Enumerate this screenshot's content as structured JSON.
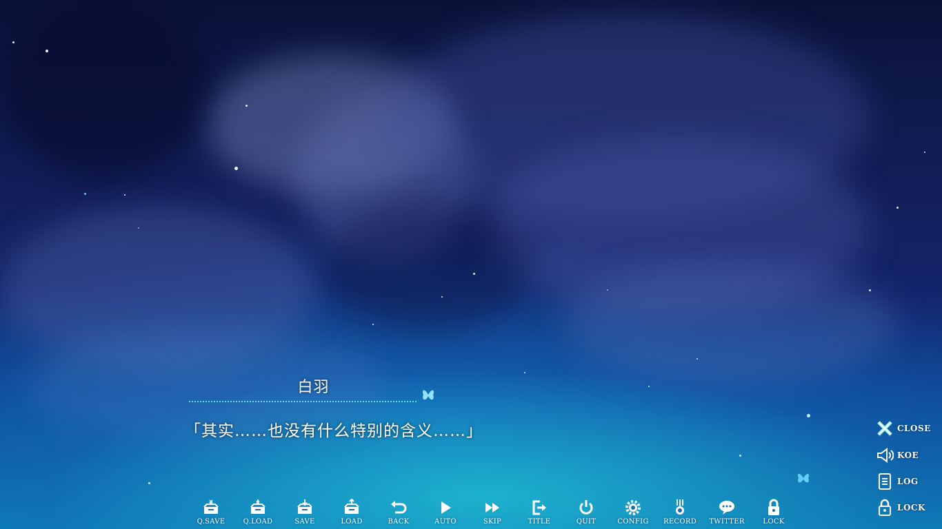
{
  "dialogue": {
    "speaker": "白羽",
    "text": "「其实……也没有什么特别的含义……」"
  },
  "toolbar": [
    {
      "id": "qsave",
      "label": "Q.SAVE",
      "icon": "quick-save-icon"
    },
    {
      "id": "qload",
      "label": "Q.LOAD",
      "icon": "quick-load-icon"
    },
    {
      "id": "save",
      "label": "SAVE",
      "icon": "save-icon"
    },
    {
      "id": "load",
      "label": "LOAD",
      "icon": "load-icon"
    },
    {
      "id": "back",
      "label": "BACK",
      "icon": "back-arrow-icon"
    },
    {
      "id": "auto",
      "label": "AUTO",
      "icon": "play-icon"
    },
    {
      "id": "skip",
      "label": "SKIP",
      "icon": "fast-forward-icon"
    },
    {
      "id": "title",
      "label": "TITLE",
      "icon": "exit-to-title-icon"
    },
    {
      "id": "quit",
      "label": "QUIT",
      "icon": "power-icon"
    },
    {
      "id": "config",
      "label": "CONFIG",
      "icon": "gear-icon"
    },
    {
      "id": "record",
      "label": "RECORD",
      "icon": "medal-icon"
    },
    {
      "id": "twitter",
      "label": "TWITTER",
      "icon": "speech-bubble-icon"
    },
    {
      "id": "lock",
      "label": "LOCK",
      "icon": "padlock-icon"
    }
  ],
  "side_menu": [
    {
      "id": "close",
      "label": "CLOSE",
      "icon": "close-x-icon"
    },
    {
      "id": "koe",
      "label": "KOE",
      "icon": "speaker-icon"
    },
    {
      "id": "log",
      "label": "LOG",
      "icon": "log-list-icon"
    },
    {
      "id": "lock",
      "label": "LOCK",
      "icon": "padlock-icon"
    }
  ],
  "colors": {
    "accent": "#5fe0f0",
    "text": "#ffffff",
    "sky_dark": "#0b1238",
    "sky_glow": "#0e7bb6"
  }
}
